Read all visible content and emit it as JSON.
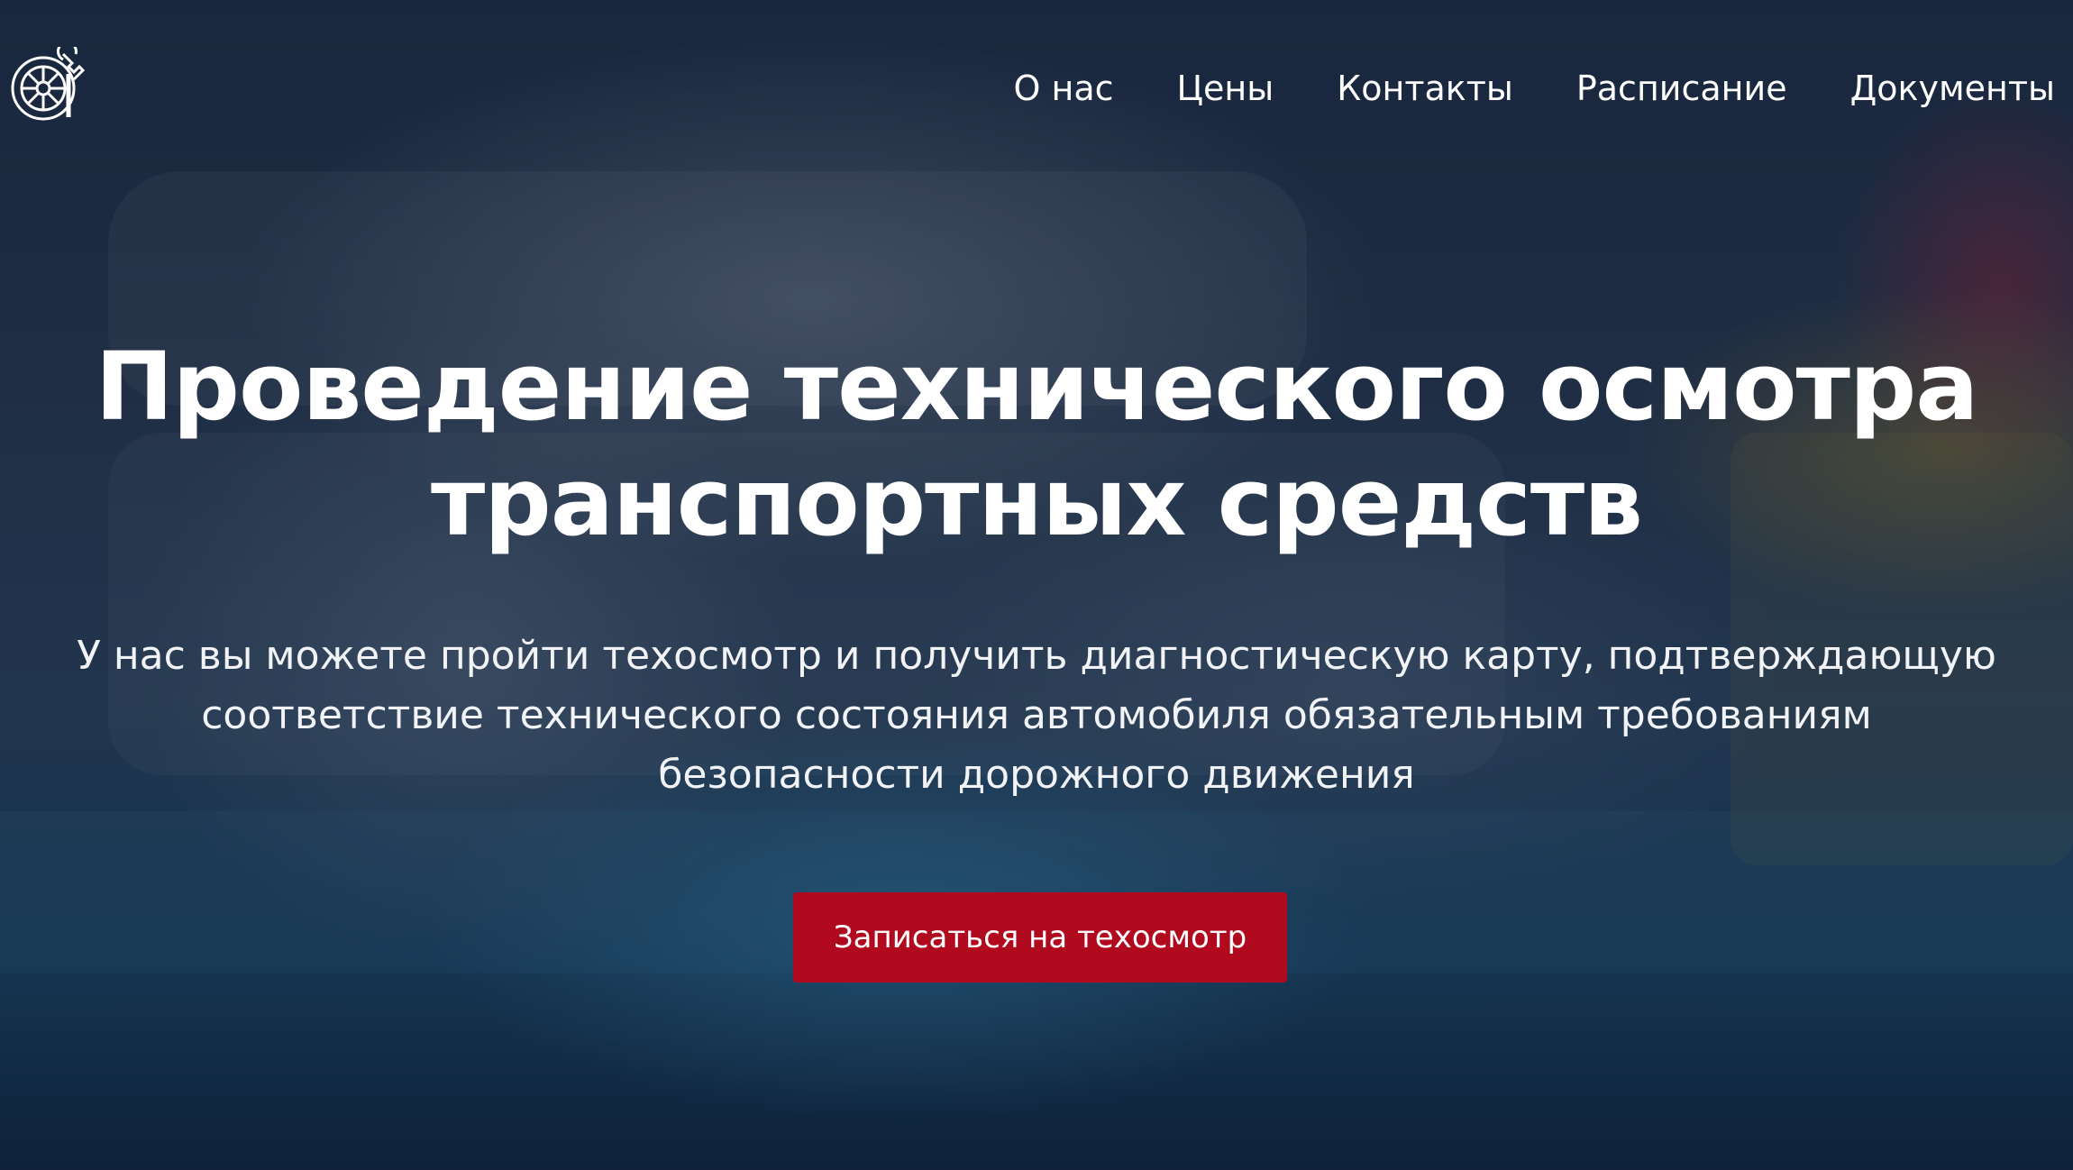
{
  "logo": {
    "icon": "wheel-wrench-icon"
  },
  "nav": {
    "items": [
      {
        "label": "О нас"
      },
      {
        "label": "Цены"
      },
      {
        "label": "Контакты"
      },
      {
        "label": "Расписание"
      },
      {
        "label": "Документы"
      }
    ]
  },
  "hero": {
    "title_line1": "Проведение технического осмотра",
    "title_line2": "транспортных средств",
    "subtitle_line1": "У нас вы можете пройти техосмотр и получить диагностическую карту, подтверждающую",
    "subtitle_line2": "соответствие технического состояния автомобиля обязательным требованиям",
    "subtitle_line3": "безопасности дорожного движения",
    "cta_label": "Записаться на техосмотр"
  },
  "colors": {
    "accent": "#b10a1e",
    "text": "#ffffff",
    "overlay": "#0e1a2d"
  }
}
